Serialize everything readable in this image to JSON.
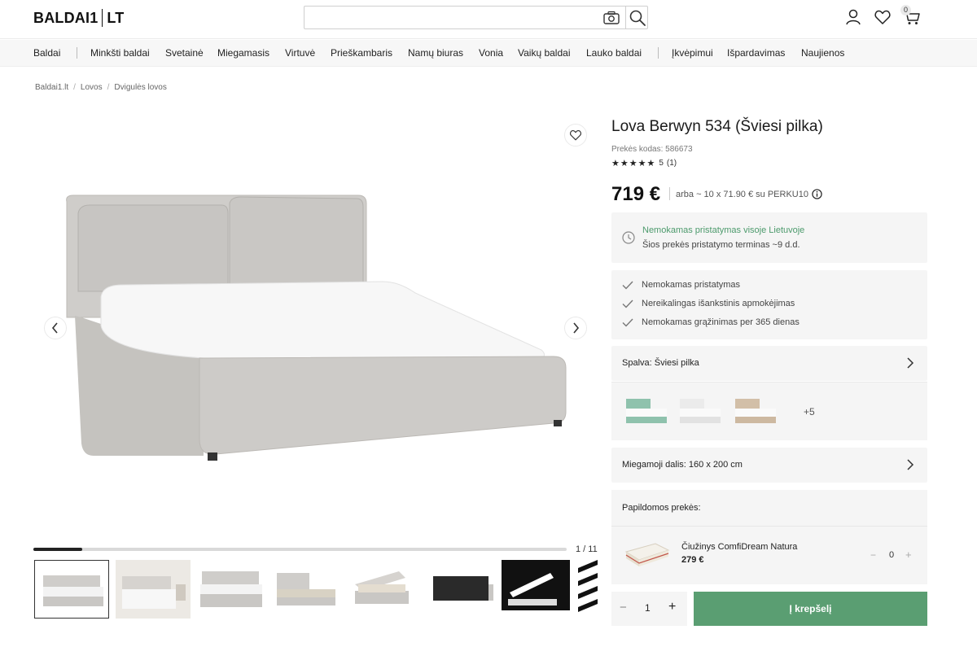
{
  "header": {
    "logo": {
      "left": "BALDAI1",
      "right": "LT"
    },
    "search": {
      "value": "",
      "placeholder": ""
    },
    "cart_count": "0"
  },
  "nav": {
    "items": [
      "Baldai",
      "Minkšti baldai",
      "Svetainė",
      "Miegamasis",
      "Virtuvė",
      "Prieškambaris",
      "Namų biuras",
      "Vonia",
      "Vaikų baldai",
      "Lauko baldai",
      "Įkvėpimui",
      "Išpardavimas",
      "Naujienos"
    ]
  },
  "breadcrumb": [
    "Baldai1.lt",
    "Lovos",
    "Dvigulės lovos"
  ],
  "gallery": {
    "counter": "1 / 11",
    "progress": 0.0909
  },
  "product": {
    "title": "Lova Berwyn 534 (Šviesi pilka)",
    "sku": "Prekės kodas: 586673",
    "stars": "★★★★★",
    "rating_value": "5",
    "rating_count": "(1)",
    "price": "719 €",
    "installment": "arba ~ 10 x 71.90 € su PERKU10"
  },
  "delivery": {
    "line1": "Nemokamas pristatymas visoje Lietuvoje",
    "line2": "Šios prekės pristatymo terminas ~9 d.d."
  },
  "perks": [
    "Nemokamas pristatymas",
    "Nereikalingas išankstinis apmokėjimas",
    "Nemokamas grąžinimas per 365 dienas"
  ],
  "color": {
    "label": "Spalva: Šviesi pilka",
    "more": "+5",
    "swatches": [
      "#b7d6c8",
      "#f2f2f2",
      "#d9c8b4"
    ]
  },
  "size": {
    "label": "Miegamoji dalis: 160 x 200 cm"
  },
  "addons": {
    "head": "Papildomos prekės:",
    "item_name": "Čiužinys ComfiDream Natura",
    "item_price": "279 €",
    "item_qty": "0",
    "minus": "−",
    "plus": "+"
  },
  "purchase": {
    "qty": "1",
    "minus": "−",
    "plus": "+",
    "cart_label": "Į krepšelį"
  },
  "colors": {
    "accent_green": "#5a9e72",
    "delivery_green": "#4c9a6c"
  }
}
